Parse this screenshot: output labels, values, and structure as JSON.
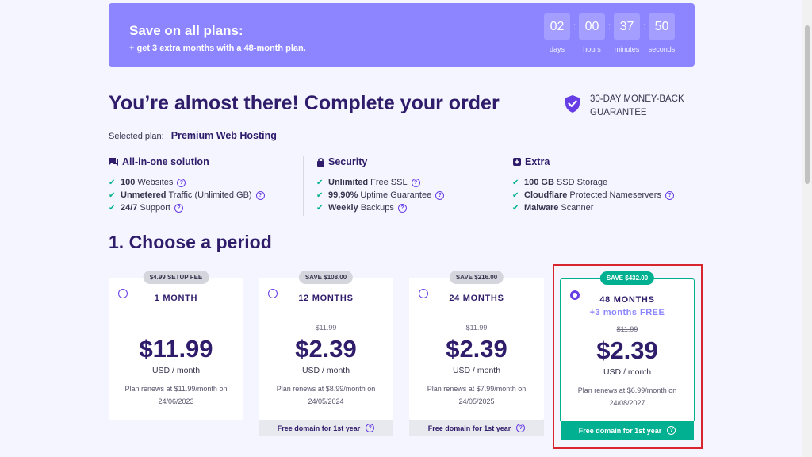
{
  "promo": {
    "title": "Save on all plans:",
    "subtitle": "+ get 3 extra months with a 48-month plan.",
    "timer": [
      {
        "value": "02",
        "label": "days"
      },
      {
        "value": "00",
        "label": "hours"
      },
      {
        "value": "37",
        "label": "minutes"
      },
      {
        "value": "50",
        "label": "seconds"
      }
    ]
  },
  "header": {
    "title": "You’re almost there! Complete your order",
    "guarantee_line1": "30-DAY MONEY-BACK",
    "guarantee_line2": "GUARANTEE",
    "selected_label": "Selected plan:",
    "selected_value": "Premium Web Hosting"
  },
  "features": [
    {
      "icon": "chat-icon",
      "title": "All-in-one solution",
      "items": [
        {
          "bold": "100",
          "text": "Websites"
        },
        {
          "bold": "Unmetered",
          "text": "Traffic (Unlimited GB)"
        },
        {
          "bold": "24/7",
          "text": "Support"
        }
      ]
    },
    {
      "icon": "lock-icon",
      "title": "Security",
      "items": [
        {
          "bold": "Unlimited",
          "text": "Free SSL"
        },
        {
          "bold": "99,90%",
          "text": "Uptime Guarantee"
        },
        {
          "bold": "Weekly",
          "text": "Backups"
        }
      ]
    },
    {
      "icon": "plus-box-icon",
      "title": "Extra",
      "items": [
        {
          "bold": "100 GB",
          "text": "SSD Storage"
        },
        {
          "bold": "Cloudflare",
          "text": "Protected Nameservers"
        },
        {
          "bold": "Malware",
          "text": "Scanner"
        }
      ]
    }
  ],
  "period_title": "1. Choose a period",
  "plans": [
    {
      "badge": "$4.99 SETUP FEE",
      "title": "1 MONTH",
      "bonus": "",
      "old_price": "",
      "price": "$11.99",
      "unit": "USD / month",
      "renew_line1": "Plan renews at $11.99/month on",
      "renew_line2": "24/06/2023",
      "footer": ""
    },
    {
      "badge": "SAVE $108.00",
      "title": "12 MONTHS",
      "bonus": "",
      "old_price": "$11.99",
      "price": "$2.39",
      "unit": "USD / month",
      "renew_line1": "Plan renews at $8.99/month on",
      "renew_line2": "24/05/2024",
      "footer": "Free domain for 1st year"
    },
    {
      "badge": "SAVE $216.00",
      "title": "24 MONTHS",
      "bonus": "",
      "old_price": "$11.99",
      "price": "$2.39",
      "unit": "USD / month",
      "renew_line1": "Plan renews at $7.99/month on",
      "renew_line2": "24/05/2025",
      "footer": "Free domain for 1st year"
    },
    {
      "badge": "SAVE $432.00",
      "title": "48 MONTHS",
      "bonus": "+3 months FREE",
      "old_price": "$11.99",
      "price": "$2.39",
      "unit": "USD / month",
      "renew_line1": "Plan renews at $6.99/month on",
      "renew_line2": "24/08/2027",
      "footer": "Free domain for 1st year"
    }
  ],
  "colors": {
    "accent": "#673de6",
    "promo": "#8c85ff",
    "success": "#00b090",
    "heading": "#2f1c6a"
  }
}
